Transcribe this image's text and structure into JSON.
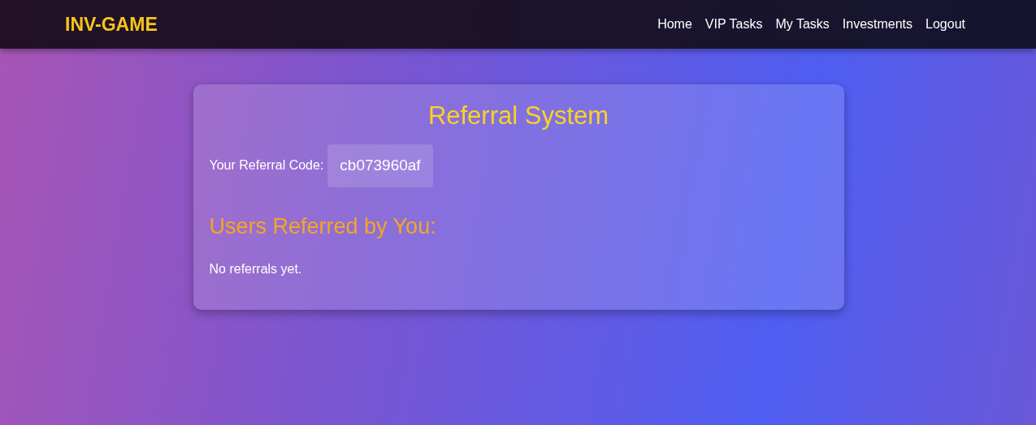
{
  "navbar": {
    "brand": "INV-GAME",
    "links": [
      {
        "label": "Home"
      },
      {
        "label": "VIP Tasks"
      },
      {
        "label": "My Tasks"
      },
      {
        "label": "Investments"
      },
      {
        "label": "Logout"
      }
    ]
  },
  "card": {
    "title": "Referral System",
    "code_label": "Your Referral Code:",
    "code": "cb073960af",
    "referred_heading": "Users Referred by You:",
    "empty_message": "No referrals yet."
  }
}
